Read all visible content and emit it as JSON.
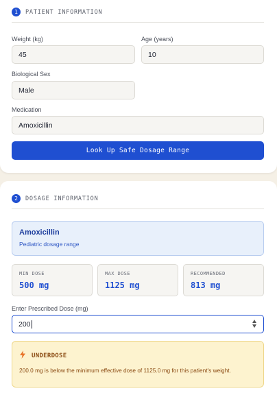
{
  "patient_section": {
    "step": "1",
    "title": "PATIENT INFORMATION",
    "weight_label": "Weight (kg)",
    "weight_value": "45",
    "age_label": "Age (years)",
    "age_value": "10",
    "sex_label": "Biological Sex",
    "sex_value": "Male",
    "medication_label": "Medication",
    "medication_value": "Amoxicillin",
    "lookup_button": "Look Up Safe Dosage Range"
  },
  "dosage_section": {
    "step": "2",
    "title": "DOSAGE INFORMATION",
    "med_name": "Amoxicillin",
    "med_subtitle": "Pediatric dosage range",
    "stats": [
      {
        "label": "MIN DOSE",
        "value": "500 mg"
      },
      {
        "label": "MAX DOSE",
        "value": "1125 mg"
      },
      {
        "label": "RECOMMENDED",
        "value": "813 mg"
      }
    ],
    "dose_label": "Enter Prescribed Dose (mg)",
    "dose_value": "200",
    "warning": {
      "icon": "lightning-icon",
      "title": "UNDERDOSE",
      "message": "200.0 mg is below the minimum effective dose of 1125.0 mg for this patient's weight."
    }
  },
  "colors": {
    "accent": "#1f4fd1",
    "background": "#f5f0e6",
    "warning_bg": "#fdf3cf",
    "warning_text": "#8a4a12",
    "info_bg": "#e8f0fb"
  }
}
